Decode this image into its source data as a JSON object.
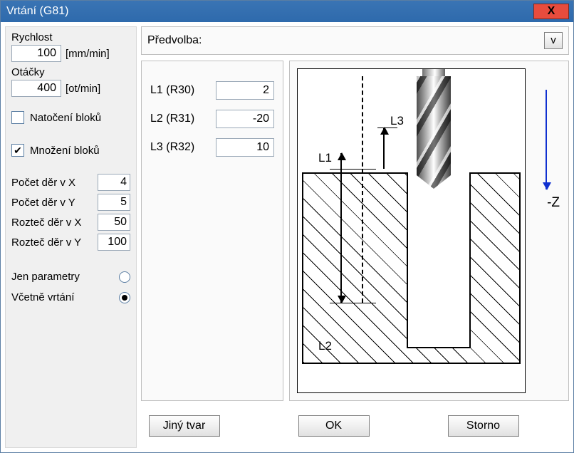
{
  "titlebar": {
    "title": "Vrtání (G81)",
    "close": "X"
  },
  "left": {
    "speed_label": "Rychlost",
    "speed_value": "100",
    "speed_unit": "[mm/min]",
    "rpm_label": "Otáčky",
    "rpm_value": "400",
    "rpm_unit": "[ot/min]",
    "cb_rotate_label": "Natočení bloků",
    "cb_rotate_checked": false,
    "cb_multiply_label": "Množení bloků",
    "cb_multiply_checked": true,
    "holes_x_label": "Počet děr v X",
    "holes_x_value": "4",
    "holes_y_label": "Počet děr v Y",
    "holes_y_value": "5",
    "pitch_x_label": "Rozteč děr v X",
    "pitch_x_value": "50",
    "pitch_y_label": "Rozteč děr v Y",
    "pitch_y_value": "100",
    "radio_params_label": "Jen parametry",
    "radio_params_checked": false,
    "radio_full_label": "Včetně vrtání",
    "radio_full_checked": true
  },
  "preset": {
    "label": "Předvolba:",
    "v_btn": "v"
  },
  "params": {
    "l1_label": "L1 (R30)",
    "l1_value": "2",
    "l2_label": "L2 (R31)",
    "l2_value": "-20",
    "l3_label": "L3 (R32)",
    "l3_value": "10"
  },
  "diagram": {
    "l1": "L1",
    "l2": "L2",
    "l3": "L3",
    "z_axis": "-Z"
  },
  "buttons": {
    "other_shape": "Jiný tvar",
    "ok": "OK",
    "cancel": "Storno"
  }
}
